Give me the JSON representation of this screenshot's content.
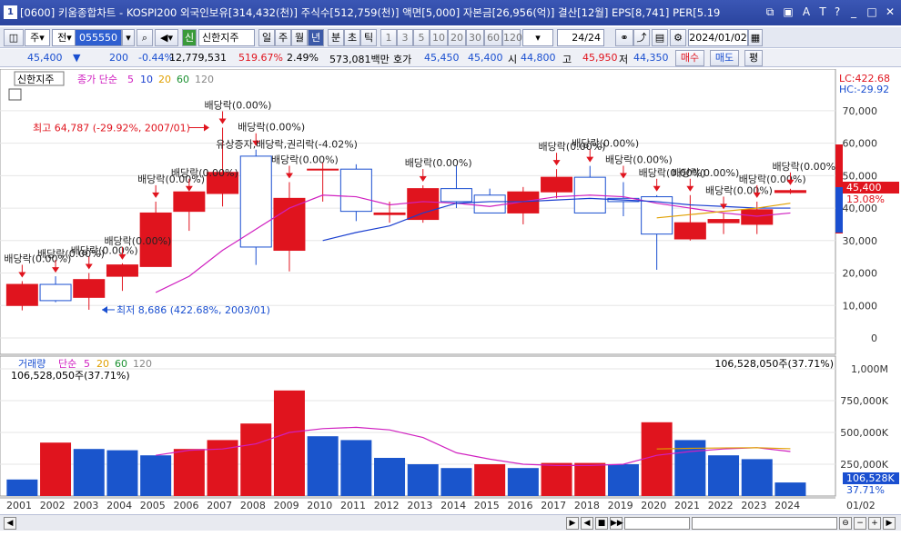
{
  "window": {
    "number": "1",
    "title": "[0600] 키움종합차트 - KOSPI200 외국인보유[314,432(천)] 주식수[512,759(천)] 액면[5,000] 자본금[26,956(억)] 결산[12월] EPS[8,741] PER[5.19",
    "icons": [
      "restore-icon",
      "detach-icon",
      "font-icon",
      "text-icon",
      "help-icon",
      "minimize-icon",
      "maximize-icon",
      "close-icon"
    ]
  },
  "toolbar": {
    "mode1": "주",
    "mode2": "전",
    "code": "055550",
    "stock_name": "신한지주",
    "period_buttons": [
      "일",
      "주",
      "월",
      "년",
      "분",
      "초",
      "틱"
    ],
    "active_period": "년",
    "interval_buttons": [
      "1",
      "3",
      "5",
      "10",
      "20",
      "30",
      "60",
      "120"
    ],
    "count": "24",
    "count_total": "/24",
    "date": "2024/01/02"
  },
  "quote": {
    "price": "45,400",
    "change_symbol": "▼",
    "change": "200",
    "change_pct": "-0.44%",
    "volume": "12,779,531",
    "volume_pct": "519.67%",
    "turnover_pct": "2.49%",
    "amount": "573,081백만",
    "ask_label": "호가",
    "ask": "45,450",
    "bid": "45,400",
    "open_label": "시",
    "open": "44,800",
    "high_label": "고",
    "high": "45,950",
    "low_label": "저",
    "low": "44,350",
    "buy_button": "매수",
    "sell_button": "매도",
    "eval_button": "평"
  },
  "price_panel": {
    "title": "신한지주",
    "ma_label": "종가 단순",
    "ma_periods": [
      "5",
      "10",
      "20",
      "60",
      "120"
    ],
    "ma_colors": [
      "#d020c0",
      "#1a3fd0",
      "#e0a000",
      "#1a9030",
      "#888888"
    ],
    "lc_label": "LC:422.68",
    "hc_label": "HC:-29.92",
    "current_price_tag": "45,400",
    "current_pct_tag": "13.08%",
    "y_ticks": [
      "70,000",
      "60,000",
      "50,000",
      "40,000",
      "30,000",
      "20,000",
      "10,000",
      "0"
    ],
    "high_annotation": "최고 64,787 (-29.92%, 2007/01)",
    "low_annotation": "최저 8,686 (422.68%, 2003/01)",
    "dividend_label": "배당락(0.00%)",
    "rights_label": "유상증자,배당락,권리락(-4.02%)"
  },
  "volume_panel": {
    "title": "거래량",
    "ma_label": "단순",
    "ma_periods": [
      "5",
      "20",
      "60",
      "120"
    ],
    "ma_colors": [
      "#d020c0",
      "#e0a000",
      "#1a9030",
      "#888888"
    ],
    "value_label": "106,528,050주(37.71%)",
    "current_tag": "106,528K",
    "current_pct": "37.71%",
    "y_ticks": [
      "1,000M",
      "750,000K",
      "500,000K",
      "250,000K"
    ]
  },
  "x_axis": {
    "labels": [
      "2001",
      "2002",
      "2003",
      "2004",
      "2005",
      "2006",
      "2007",
      "2008",
      "2009",
      "2010",
      "2011",
      "2012",
      "2013",
      "2014",
      "2015",
      "2016",
      "2017",
      "2018",
      "2019",
      "2020",
      "2021",
      "2022",
      "2023",
      "2024"
    ],
    "right_label": "01/02"
  },
  "chart_data": [
    {
      "type": "candlestick",
      "title": "신한지주",
      "x": [
        "2001",
        "2002",
        "2003",
        "2004",
        "2005",
        "2006",
        "2007",
        "2008",
        "2009",
        "2010",
        "2011",
        "2012",
        "2013",
        "2014",
        "2015",
        "2016",
        "2017",
        "2018",
        "2019",
        "2020",
        "2021",
        "2022",
        "2023",
        "2024"
      ],
      "open": [
        10000,
        16500,
        12500,
        19000,
        22000,
        39000,
        44500,
        56000,
        27000,
        52000,
        52000,
        38000,
        36500,
        46000,
        44000,
        38500,
        45000,
        49500,
        43000,
        43500,
        30500,
        35500,
        35000,
        44800
      ],
      "high": [
        17500,
        19000,
        20000,
        23000,
        42000,
        44000,
        64787,
        58000,
        48000,
        54000,
        53500,
        42000,
        47000,
        53000,
        46000,
        46500,
        52000,
        53000,
        48000,
        44000,
        44000,
        38500,
        42000,
        45950
      ],
      "low": [
        8500,
        11000,
        8686,
        14500,
        22000,
        33000,
        40500,
        22500,
        20500,
        42000,
        36000,
        35500,
        35500,
        40000,
        39000,
        35000,
        43000,
        38500,
        37500,
        21000,
        30000,
        32000,
        32000,
        44350
      ],
      "close": [
        16500,
        11500,
        18000,
        22500,
        38500,
        45000,
        51000,
        28000,
        43000,
        52000,
        39000,
        38500,
        46000,
        42000,
        38500,
        45000,
        49500,
        38500,
        42000,
        32000,
        35500,
        36500,
        39500,
        45400
      ],
      "ylim": [
        0,
        75000
      ],
      "moving_averages": [
        {
          "name": "5",
          "color": "#d020c0",
          "values": [
            null,
            null,
            null,
            null,
            14000,
            19000,
            27000,
            33500,
            40000,
            44000,
            43500,
            41000,
            42000,
            41500,
            40500,
            42000,
            43500,
            44000,
            43500,
            41500,
            40000,
            38500,
            37500,
            38500
          ]
        },
        {
          "name": "10",
          "color": "#1a3fd0",
          "values": [
            null,
            null,
            null,
            null,
            null,
            null,
            null,
            null,
            null,
            30000,
            32500,
            34500,
            38500,
            41500,
            42000,
            42000,
            42500,
            43000,
            42500,
            42000,
            41000,
            40500,
            40000,
            40000
          ]
        },
        {
          "name": "20",
          "color": "#e0a000",
          "values": [
            null,
            null,
            null,
            null,
            null,
            null,
            null,
            null,
            null,
            null,
            null,
            null,
            null,
            null,
            null,
            null,
            null,
            null,
            null,
            37000,
            38000,
            39000,
            40000,
            41500
          ]
        }
      ]
    },
    {
      "type": "bar",
      "title": "거래량",
      "x": [
        "2001",
        "2002",
        "2003",
        "2004",
        "2005",
        "2006",
        "2007",
        "2008",
        "2009",
        "2010",
        "2011",
        "2012",
        "2013",
        "2014",
        "2015",
        "2016",
        "2017",
        "2018",
        "2019",
        "2020",
        "2021",
        "2022",
        "2023",
        "2024"
      ],
      "values": [
        130000,
        420000,
        370000,
        360000,
        320000,
        370000,
        440000,
        570000,
        830000,
        470000,
        440000,
        300000,
        250000,
        220000,
        250000,
        220000,
        260000,
        260000,
        250000,
        580000,
        440000,
        320000,
        290000,
        106528
      ],
      "units": "K",
      "ylim": [
        0,
        1000000
      ],
      "up": [
        false,
        true,
        false,
        false,
        false,
        true,
        true,
        true,
        true,
        false,
        false,
        false,
        false,
        false,
        true,
        false,
        true,
        true,
        false,
        true,
        false,
        false,
        false,
        false
      ],
      "moving_averages": [
        {
          "name": "5",
          "color": "#d020c0",
          "values": [
            null,
            null,
            null,
            null,
            320000,
            360000,
            370000,
            410000,
            500000,
            530000,
            540000,
            520000,
            460000,
            340000,
            290000,
            250000,
            240000,
            240000,
            250000,
            320000,
            350000,
            370000,
            380000,
            350000
          ]
        },
        {
          "name": "20",
          "color": "#e0a000",
          "values": [
            null,
            null,
            null,
            null,
            null,
            null,
            null,
            null,
            null,
            null,
            null,
            null,
            null,
            null,
            null,
            null,
            null,
            null,
            null,
            370000,
            375000,
            378000,
            380000,
            372000
          ]
        }
      ]
    }
  ]
}
